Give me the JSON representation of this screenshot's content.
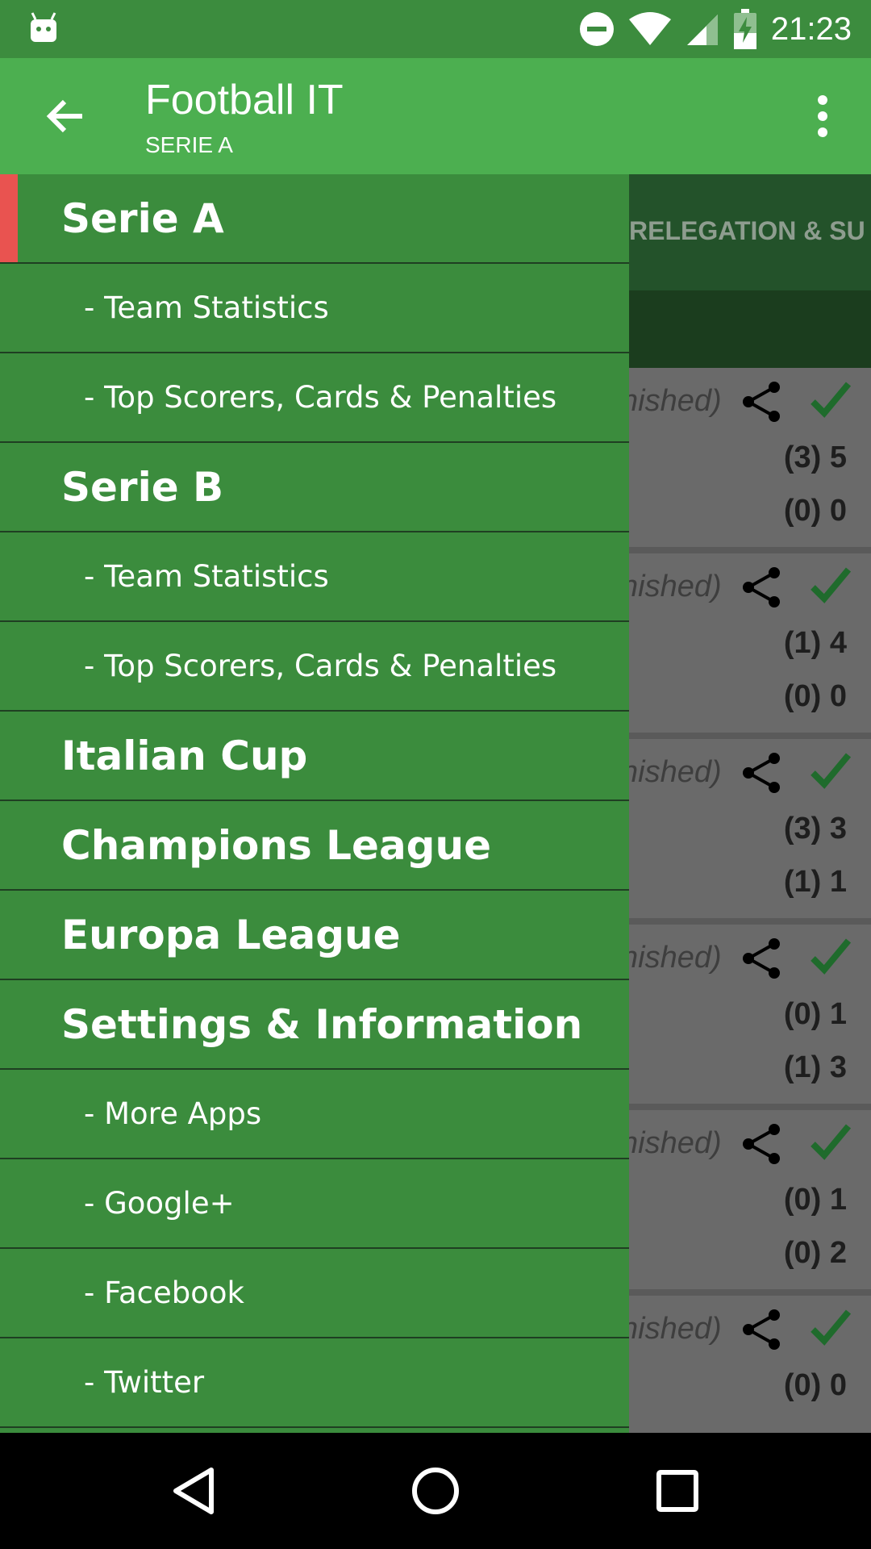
{
  "status_bar": {
    "time": "21:23",
    "icons": [
      "android-icon",
      "do-not-disturb-icon",
      "wifi-icon",
      "signal-icon",
      "battery-charging-icon"
    ]
  },
  "app_bar": {
    "title": "Football IT",
    "subtitle": "SERIE A",
    "icons": [
      "back-arrow-icon",
      "overflow-menu-icon"
    ]
  },
  "background": {
    "tab_label": "RELEGATION & SU",
    "matches": [
      {
        "status": "nished)",
        "home": "(3)  5",
        "away": "(0)  0"
      },
      {
        "status": "nished)",
        "home": "(1)  4",
        "away": "(0)  0"
      },
      {
        "status": "nished)",
        "home": "(3)  3",
        "away": "(1)  1"
      },
      {
        "status": "nished)",
        "home": "(0)  1",
        "away": "(1)  3"
      },
      {
        "status": "nished)",
        "home": "(0)  1",
        "away": "(0)  2"
      },
      {
        "status": "nished)",
        "home": "(0)  0",
        "away": ""
      }
    ]
  },
  "drawer": {
    "items": [
      {
        "label": "Serie A",
        "type": "section",
        "active": true
      },
      {
        "label": "- Team Statistics",
        "type": "sub"
      },
      {
        "label": "- Top Scorers, Cards & Penalties",
        "type": "sub"
      },
      {
        "label": "Serie B",
        "type": "section"
      },
      {
        "label": "- Team Statistics",
        "type": "sub"
      },
      {
        "label": "- Top Scorers, Cards & Penalties",
        "type": "sub"
      },
      {
        "label": "Italian Cup",
        "type": "section"
      },
      {
        "label": "Champions League",
        "type": "section"
      },
      {
        "label": "Europa League",
        "type": "section"
      },
      {
        "label": "Settings & Information",
        "type": "section"
      },
      {
        "label": "- More Apps",
        "type": "sub"
      },
      {
        "label": "- Google+",
        "type": "sub"
      },
      {
        "label": "- Facebook",
        "type": "sub"
      },
      {
        "label": "- Twitter",
        "type": "sub"
      }
    ]
  },
  "nav_bar": {
    "icons": [
      "back-triangle-icon",
      "home-circle-icon",
      "recents-square-icon"
    ]
  },
  "colors": {
    "status_bar": "#3c8c3e",
    "app_bar": "#4caf50",
    "drawer": "#3b8c3d",
    "active_marker": "#e95350",
    "check": "#1f6b2c"
  }
}
